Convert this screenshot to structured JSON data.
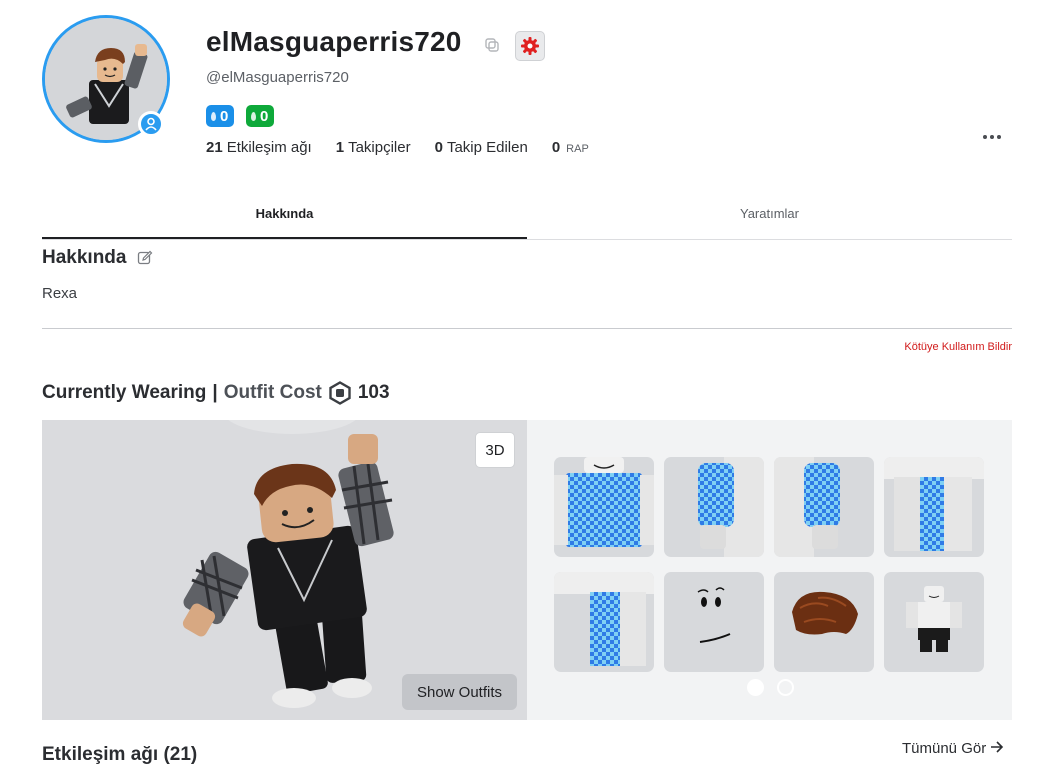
{
  "profile": {
    "display_name": "elMasguaperris720",
    "username": "@elMasguaperris720",
    "badge_blue_count": "0",
    "badge_green_count": "0",
    "stats": [
      {
        "value": "21",
        "label": "Etkileşim ağı"
      },
      {
        "value": "1",
        "label": "Takipçiler"
      },
      {
        "value": "0",
        "label": "Takip Edilen"
      },
      {
        "value": "0",
        "label": "RAP"
      }
    ]
  },
  "tabs": [
    {
      "label": "Hakkında",
      "active": true
    },
    {
      "label": "Yaratımlar",
      "active": false
    }
  ],
  "about": {
    "title": "Hakkında",
    "text": "Rexa",
    "report_label": "Kötüye Kullanım Bildir"
  },
  "wearing": {
    "title": "Currently Wearing",
    "separator": "|",
    "cost_label": "Outfit Cost",
    "cost_value": "103",
    "btn_3d": "3D",
    "btn_outfits": "Show Outfits",
    "items": [
      {
        "icon": "shirt-front-item"
      },
      {
        "icon": "shirt-left-arm-item"
      },
      {
        "icon": "shirt-right-arm-item"
      },
      {
        "icon": "pants-right-leg-item"
      },
      {
        "icon": "pants-left-leg-item"
      },
      {
        "icon": "face-item"
      },
      {
        "icon": "hair-item"
      },
      {
        "icon": "outfit-body-item"
      }
    ],
    "pages": 2,
    "current_page": 1
  },
  "network": {
    "title": "Etkileşim ağı (21)",
    "see_all": "Tümünü Gör"
  },
  "colors": {
    "accent_blue": "#2a9cf0",
    "badge_green": "#0ea93a",
    "report_red": "#d11a1a"
  }
}
